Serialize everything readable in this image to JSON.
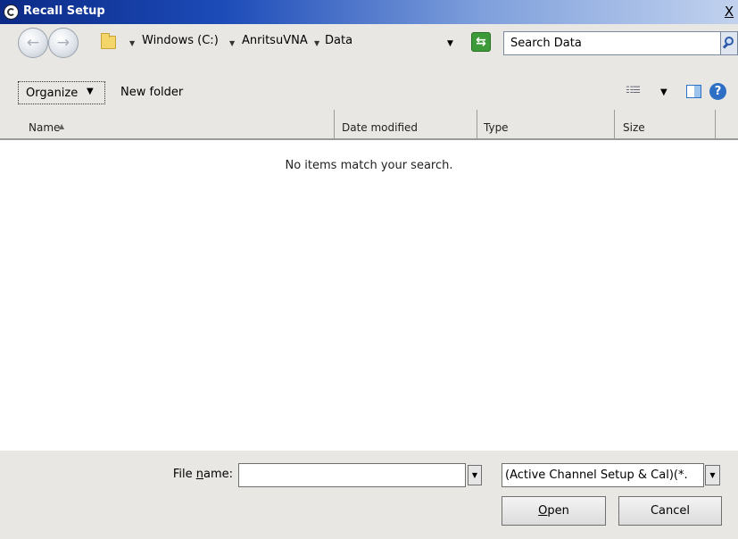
{
  "window": {
    "title": "Recall Setup",
    "close_glyph": "X"
  },
  "navigation": {
    "breadcrumbs": [
      "Windows (C:)",
      "AnritsuVNA",
      "Data"
    ],
    "search_placeholder": "Search Data"
  },
  "toolbar": {
    "organize_label": "Organize",
    "new_folder_label": "New folder"
  },
  "columns": [
    "Name",
    "Date modified",
    "Type",
    "Size"
  ],
  "file_list": {
    "items": [],
    "empty_message": "No items match your search."
  },
  "footer": {
    "file_name_label_pre": "File ",
    "file_name_label_underlined": "n",
    "file_name_label_post": "ame:",
    "file_name_value": "",
    "file_type_value": "(Active Channel Setup & Cal)(*.",
    "open_label_underlined": "O",
    "open_label_rest": "pen",
    "cancel_label": "Cancel"
  }
}
